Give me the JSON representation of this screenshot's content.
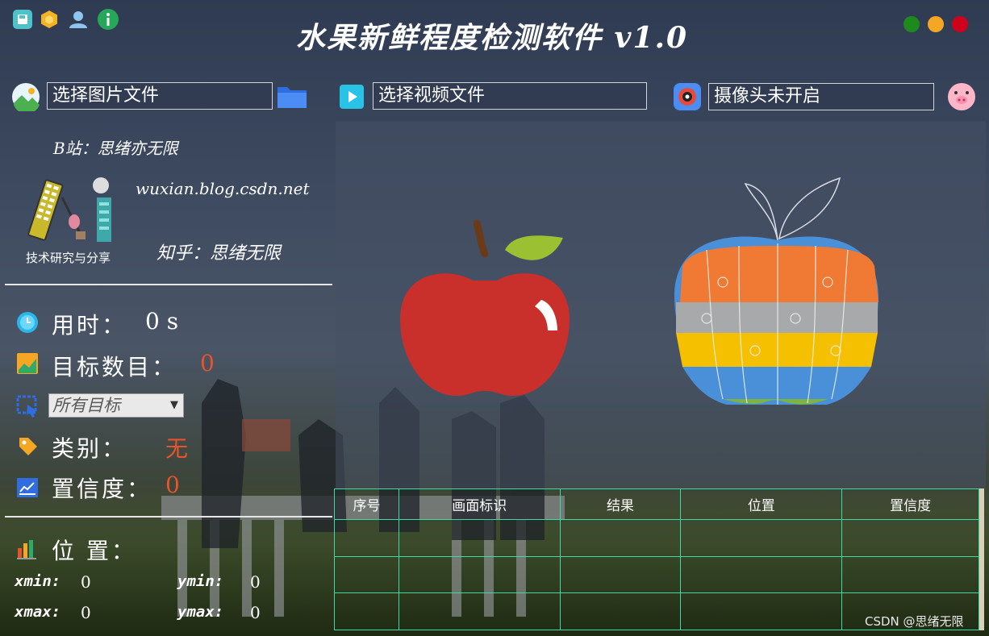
{
  "app": {
    "title": "水果新鲜程度检测软件 v1.0"
  },
  "inputs": {
    "image_field": "选择图片文件",
    "video_field": "选择视频文件",
    "camera_field": "摄像头未开启"
  },
  "info": {
    "bilibili": "B站：思绪亦无限",
    "blog": "wuxian.blog.csdn.net",
    "logo_caption": "技术研究与分享",
    "zhihu": "知乎：思绪无限"
  },
  "stats": {
    "time_label": "用时：",
    "time_value": "0 s",
    "count_label": "目标数目：",
    "count_value": "0",
    "target_select": "所有目标",
    "class_label": "类别：",
    "class_value": "无",
    "conf_label": "置信度：",
    "conf_value": "0",
    "position_label": "位 置："
  },
  "coords": {
    "xmin_label": "xmin:",
    "xmin_value": "0",
    "ymin_label": "ymin:",
    "ymin_value": "0",
    "xmax_label": "xmax:",
    "xmax_value": "0",
    "ymax_label": "ymax:",
    "ymax_value": "0"
  },
  "table": {
    "columns": [
      "序号",
      "画面标识",
      "结果",
      "位置",
      "置信度"
    ]
  },
  "colors": {
    "accent_value": "#e8542a",
    "table_border": "#3fd9a5",
    "window_close": "#d0021b",
    "window_min": "#f5a623",
    "window_max": "#1e8a1e"
  },
  "watermark": "CSDN @思绪无限"
}
